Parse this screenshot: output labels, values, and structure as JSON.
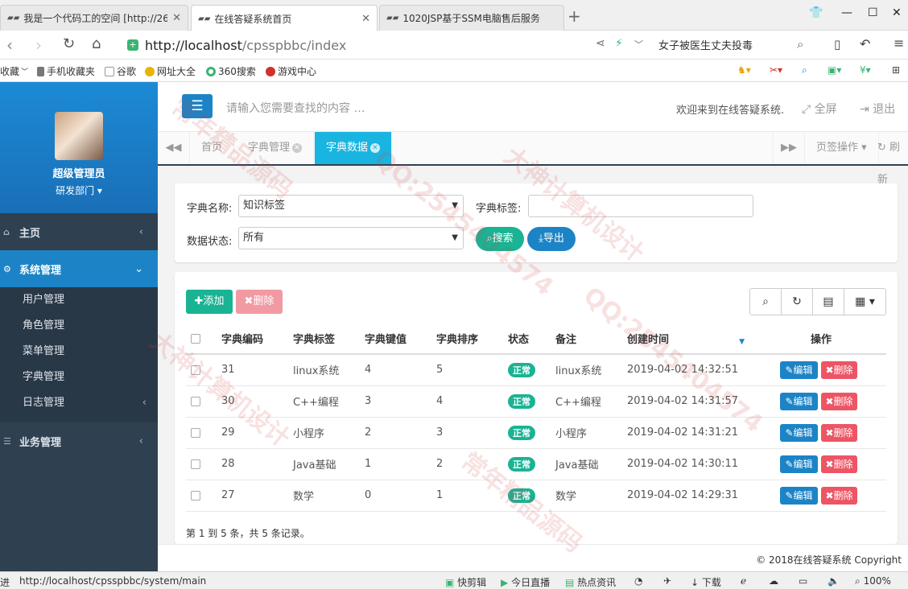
{
  "browser": {
    "tabs": [
      {
        "label": "我是一个代码工的空间 [http://26"
      },
      {
        "label": "在线答疑系统首页"
      },
      {
        "label": "1020JSP基于SSM电脑售后服务"
      }
    ],
    "url_host": "http://localhost",
    "url_path": "/cpsspbbc/index",
    "search_query": "女子被医生丈夫投毒",
    "bookmarks": [
      "收藏",
      "手机收藏夹",
      "谷歌",
      "网址大全",
      "360搜索",
      "游戏中心"
    ],
    "status_url": "http://localhost/cpsspbbc/system/main",
    "status_left": "进",
    "status_items": [
      "快剪辑",
      "今日直播",
      "热点资讯",
      "下载",
      "100%"
    ]
  },
  "sidebar": {
    "user_name": "超级管理员",
    "user_dept": "研发部门",
    "menus": [
      {
        "label": "主页"
      },
      {
        "label": "系统管理"
      },
      {
        "label": "业务管理"
      }
    ],
    "submenus": [
      {
        "label": "用户管理"
      },
      {
        "label": "角色管理"
      },
      {
        "label": "菜单管理"
      },
      {
        "label": "字典管理"
      },
      {
        "label": "日志管理"
      }
    ]
  },
  "header": {
    "search_placeholder": "请输入您需要查找的内容 …",
    "welcome": "欢迎来到在线答疑系统.",
    "fullscreen": "全屏",
    "logout": "退出"
  },
  "content_tabs": {
    "tabs": [
      {
        "label": "首页"
      },
      {
        "label": "字典管理"
      },
      {
        "label": "字典数据"
      }
    ],
    "page_ops": "页签操作",
    "refresh": "刷新"
  },
  "filter": {
    "dict_name_label": "字典名称:",
    "dict_name_value": "知识标签",
    "dict_label_label": "字典标签:",
    "dict_label_value": "",
    "status_label": "数据状态:",
    "status_value": "所有",
    "search_btn": "搜索",
    "export_btn": "导出"
  },
  "table": {
    "add_btn": "添加",
    "delete_btn": "删除",
    "columns": [
      "字典编码",
      "字典标签",
      "字典键值",
      "字典排序",
      "状态",
      "备注",
      "创建时间",
      "操作"
    ],
    "rows": [
      {
        "code": "31",
        "label": "linux系统",
        "value": "4",
        "sort": "5",
        "status": "正常",
        "remark": "linux系统",
        "time": "2019-04-02 14:32:51"
      },
      {
        "code": "30",
        "label": "C++编程",
        "value": "3",
        "sort": "4",
        "status": "正常",
        "remark": "C++编程",
        "time": "2019-04-02 14:31:57"
      },
      {
        "code": "29",
        "label": "小程序",
        "value": "2",
        "sort": "3",
        "status": "正常",
        "remark": "小程序",
        "time": "2019-04-02 14:31:21"
      },
      {
        "code": "28",
        "label": "Java基础",
        "value": "1",
        "sort": "2",
        "status": "正常",
        "remark": "Java基础",
        "time": "2019-04-02 14:30:11"
      },
      {
        "code": "27",
        "label": "数学",
        "value": "0",
        "sort": "1",
        "status": "正常",
        "remark": "数学",
        "time": "2019-04-02 14:29:31"
      }
    ],
    "edit_label": "编辑",
    "row_delete_label": "删除",
    "page_info": "第 1 到 5 条，共 5 条记录。"
  },
  "footer": {
    "copyright": "© 2018在线答疑系统 Copyright"
  },
  "watermarks": [
    "QQ:2545404574",
    "大神计算机设计",
    "常年精品源码"
  ],
  "colors": {
    "primary": "#1c84c6",
    "success": "#1ab394",
    "danger": "#ed5565",
    "sidebar": "#2f4050",
    "active_tab": "#1ab4e0"
  }
}
